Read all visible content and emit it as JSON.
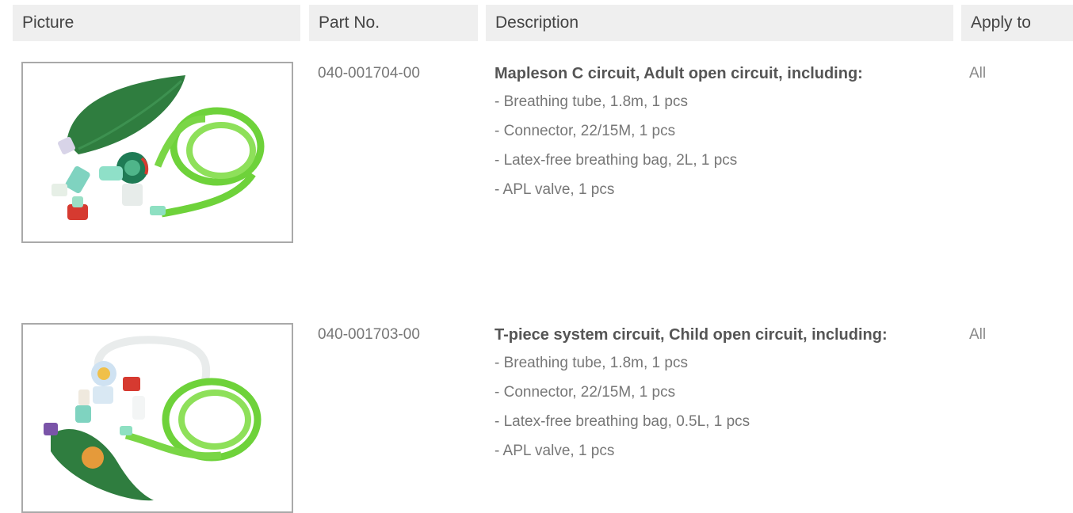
{
  "table": {
    "headers": {
      "picture": "Picture",
      "part_no": "Part No.",
      "description": "Description",
      "apply_to": "Apply to"
    },
    "rows": [
      {
        "part_no": "040-001704-00",
        "title": "Mapleson C circuit, Adult open circuit, including:",
        "items": [
          "- Breathing tube, 1.8m, 1 pcs",
          "- Connector, 22/15M, 1 pcs",
          "- Latex-free breathing bag, 2L, 1 pcs",
          "- APL valve, 1 pcs"
        ],
        "apply_to": "All",
        "image": "mapleson-c-circuit-product-photo"
      },
      {
        "part_no": "040-001703-00",
        "title": "T-piece system circuit, Child open circuit, including:",
        "items": [
          "- Breathing tube, 1.8m, 1 pcs",
          "- Connector, 22/15M, 1 pcs",
          "- Latex-free breathing bag, 0.5L, 1 pcs",
          "- APL valve, 1 pcs"
        ],
        "apply_to": "All",
        "image": "t-piece-circuit-product-photo"
      }
    ]
  },
  "colors": {
    "header_bg": "#efefef",
    "tube_green": "#6ed23a",
    "bag_green": "#2f7d3f",
    "valve_red": "#d63a30"
  }
}
